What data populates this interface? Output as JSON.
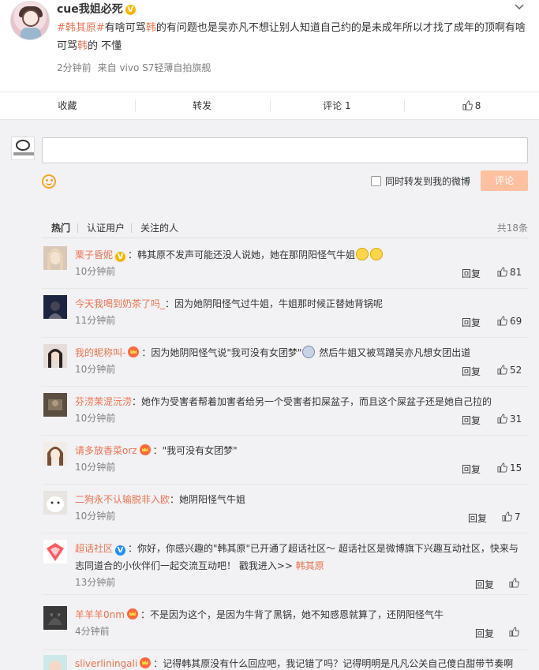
{
  "post": {
    "author": "cue我姐必死",
    "text_parts": {
      "topic": "#韩其原#",
      "p1": "有啥可骂",
      "h1": "韩",
      "p2": "的有问题也是吴亦凡不想让别人知道自己约的是未成年所以才找了成年的顶啊有啥可骂",
      "h2": "韩",
      "p3": "的 不懂"
    },
    "time": "2分钟前",
    "source": "来自 vivo S7轻薄自拍旗舰"
  },
  "actions": {
    "favorite": "收藏",
    "forward": "转发",
    "comment": "评论 1",
    "like_count": "8"
  },
  "composer": {
    "placeholder": "",
    "forward_label": "同时转发到我的微博",
    "submit_label": "评论"
  },
  "tabs": {
    "hot": "热门",
    "verified": "认证用户",
    "following": "关注的人",
    "total": "共18条"
  },
  "comments": [
    {
      "user": "栗子昏妮",
      "text": "：韩其原不发声可能还没人说她，她在那阴阳怪气牛姐",
      "time": "10分钟前",
      "reply": "回复",
      "likes": "81"
    },
    {
      "user": "今天我喝到奶茶了吗_",
      "text": "：因为她阴阳怪气过牛姐，牛姐那时候正替她背锅呢",
      "time": "11分钟前",
      "reply": "回复",
      "likes": "69"
    },
    {
      "user": "我的昵称叫-",
      "text_a": "：因为她阴阳怪气说\"我可没有女团梦\"",
      "text_b": "然后牛姐又被骂蹭吴亦凡想女团出道",
      "time": "10分钟前",
      "reply": "回复",
      "likes": "52"
    },
    {
      "user": "芬涝茉湜沅涝",
      "text": "：她作为受害者帮着加害者给另一个受害者扣屎盆子，而且这个屎盆子还是她自己拉的",
      "time": "10分钟前",
      "reply": "回复",
      "likes": "31"
    },
    {
      "user": "请多放香菜orz",
      "text": "：\"我可没有女团梦\"",
      "time": "10分钟前",
      "reply": "回复",
      "likes": "15"
    },
    {
      "user": "二狗永不认输脱非入欧",
      "text": "：她阴阳怪气牛姐",
      "time": "10分钟前",
      "reply": "回复",
      "likes": "7"
    },
    {
      "user": "超话社区",
      "text": "：你好，你感兴趣的\"韩其原\"已开通了超话社区～ 超话社区是微博旗下兴趣互动社区，快来与志同道合的小伙伴们一起交流互动吧！ 戳我进入>> ",
      "link": "韩其原",
      "time": "13分钟前",
      "reply": "回复",
      "likes": ""
    },
    {
      "user": "羊羊羊0nm",
      "text": "：不是因为这个，是因为牛背了黑锅，她不知感恩就算了，还阴阳怪气牛",
      "time": "4分钟前",
      "reply": "回复",
      "likes": ""
    },
    {
      "user": "sliverliningali",
      "text": "：记得韩其原没有什么回应吧，我记错了吗？记得明明是凡凡公关自己傻白甜带节奏啊",
      "time": "",
      "reply": "",
      "likes": ""
    }
  ],
  "colors": {
    "accent": "#eb7350",
    "vip": "#f6b700",
    "submit_disabled": "#ffc09f",
    "background": "#f2f2f5"
  }
}
